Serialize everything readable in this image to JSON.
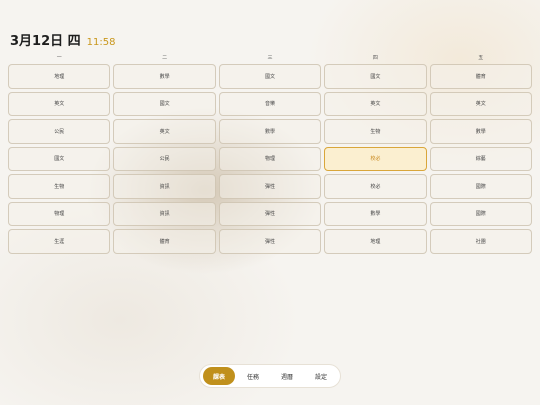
{
  "header": {
    "date": "3月12日 四",
    "time": "11:58"
  },
  "days": [
    "一",
    "二",
    "三",
    "四",
    "五"
  ],
  "rows": [
    [
      "地理",
      "數學",
      "國文",
      "國文",
      "體育"
    ],
    [
      "英文",
      "國文",
      "音樂",
      "英文",
      "英文"
    ],
    [
      "公民",
      "英文",
      "數學",
      "生物",
      "數學"
    ],
    [
      "國文",
      "公民",
      "物理",
      "校必",
      "綜藝"
    ],
    [
      "生物",
      "資訊",
      "彈性",
      "校必",
      "國際"
    ],
    [
      "物理",
      "資訊",
      "彈性",
      "數學",
      "國際"
    ],
    [
      "生涯",
      "體育",
      "彈性",
      "地理",
      "社團"
    ]
  ],
  "current_cell": {
    "row": 3,
    "col": 3
  },
  "nav": {
    "tabs": [
      "課表",
      "任務",
      "週曆",
      "設定"
    ],
    "active_index": 0
  },
  "colors": {
    "accent": "#c0901c",
    "current_cell_bg": "#fbefd0",
    "time": "#c9971d"
  }
}
